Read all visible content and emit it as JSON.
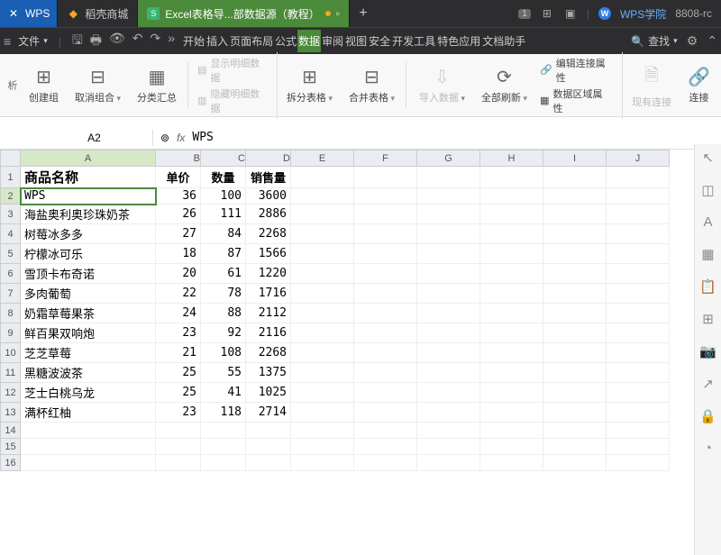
{
  "titlebar": {
    "app_tab": "WPS",
    "tab1": "稻壳商城",
    "tab2": "Excel表格导...部数据源（教程）",
    "badge": "1",
    "academy": "WPS学院",
    "version": "8808-rc"
  },
  "menubar": {
    "file": "文件",
    "items": [
      "开始",
      "插入",
      "页面布局",
      "公式",
      "数据",
      "审阅",
      "视图",
      "安全",
      "开发工具",
      "特色应用",
      "文档助手"
    ],
    "active_index": 4,
    "search": "查找"
  },
  "ribbon": {
    "prefix": "析",
    "create_group": "创建组",
    "ungroup": "取消组合",
    "subtotal": "分类汇总",
    "show_detail": "显示明细数据",
    "hide_detail": "隐藏明细数据",
    "split_table": "拆分表格",
    "merge_table": "合并表格",
    "import_data": "导入数据",
    "refresh_all": "全部刷新",
    "edit_conn": "编辑连接属性",
    "data_region": "数据区域属性",
    "existing_conn": "现有连接",
    "connections": "连接"
  },
  "formula_bar": {
    "name_box": "A2",
    "formula": "WPS"
  },
  "sheet": {
    "columns": [
      "A",
      "B",
      "C",
      "D",
      "E",
      "F",
      "G",
      "H",
      "I",
      "J"
    ],
    "headers": {
      "A": "商品名称",
      "B": "单价",
      "C": "数量",
      "D": "销售量"
    },
    "rows": [
      {
        "A": "WPS",
        "B": 36,
        "C": 100,
        "D": 3600
      },
      {
        "A": "海盐奥利奥珍珠奶茶",
        "B": 26,
        "C": 111,
        "D": 2886
      },
      {
        "A": "树莓冰多多",
        "B": 27,
        "C": 84,
        "D": 2268
      },
      {
        "A": "柠檬冰可乐",
        "B": 18,
        "C": 87,
        "D": 1566
      },
      {
        "A": "雪顶卡布奇诺",
        "B": 20,
        "C": 61,
        "D": 1220
      },
      {
        "A": "多肉葡萄",
        "B": 22,
        "C": 78,
        "D": 1716
      },
      {
        "A": "奶霜草莓果茶",
        "B": 24,
        "C": 88,
        "D": 2112
      },
      {
        "A": "鲜百果双响炮",
        "B": 23,
        "C": 92,
        "D": 2116
      },
      {
        "A": "芝芝草莓",
        "B": 21,
        "C": 108,
        "D": 2268
      },
      {
        "A": "黑糖波波茶",
        "B": 25,
        "C": 55,
        "D": 1375
      },
      {
        "A": "芝士白桃乌龙",
        "B": 25,
        "C": 41,
        "D": 1025
      },
      {
        "A": "满杯红柚",
        "B": 23,
        "C": 118,
        "D": 2714
      }
    ],
    "selected_cell": "A2",
    "visible_row_count": 16
  }
}
